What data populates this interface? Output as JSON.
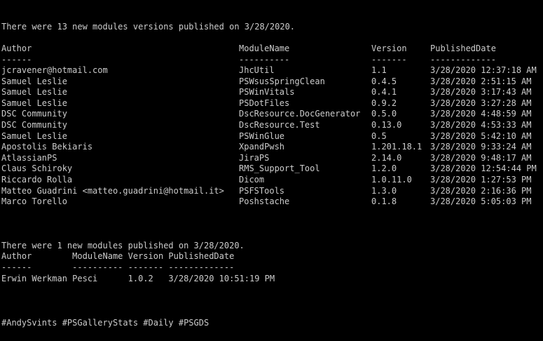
{
  "colors": {
    "background": "#000000",
    "text": "#cccccc"
  },
  "section1": {
    "summary": "There were 13 new modules versions published on 3/28/2020.",
    "headers": [
      "Author",
      "ModuleName",
      "Version",
      "PublishedDate"
    ],
    "separators": [
      "------",
      "----------",
      "-------",
      "-------------"
    ],
    "rows": [
      [
        "jcravener@hotmail.com",
        "JhcUtil",
        "1.1",
        "3/28/2020 12:37:18 AM"
      ],
      [
        "Samuel Leslie",
        "PSWsusSpringClean",
        "0.4.5",
        "3/28/2020 2:51:15 AM"
      ],
      [
        "Samuel Leslie",
        "PSWinVitals",
        "0.4.1",
        "3/28/2020 3:17:43 AM"
      ],
      [
        "Samuel Leslie",
        "PSDotFiles",
        "0.9.2",
        "3/28/2020 3:27:28 AM"
      ],
      [
        "DSC Community",
        "DscResource.DocGenerator",
        "0.5.0",
        "3/28/2020 4:48:59 AM"
      ],
      [
        "DSC Community",
        "DscResource.Test",
        "0.13.0",
        "3/28/2020 4:53:33 AM"
      ],
      [
        "Samuel Leslie",
        "PSWinGlue",
        "0.5",
        "3/28/2020 5:42:10 AM"
      ],
      [
        "Apostolis Bekiaris",
        "XpandPwsh",
        "1.201.18.1",
        "3/28/2020 9:33:24 AM"
      ],
      [
        "AtlassianPS",
        "JiraPS",
        "2.14.0",
        "3/28/2020 9:48:17 AM"
      ],
      [
        "Claus Schiroky",
        "RMS_Support_Tool",
        "1.2.0",
        "3/28/2020 12:54:44 PM"
      ],
      [
        "Riccardo Rolla",
        "Dicom",
        "1.0.11.0",
        "3/28/2020 1:27:53 PM"
      ],
      [
        "Matteo Guadrini <matteo.guadrini@hotmail.it>",
        "PSFSTools",
        "1.3.0",
        "3/28/2020 2:16:36 PM"
      ],
      [
        "Marco Torello",
        "Poshstache",
        "0.1.8",
        "3/28/2020 5:05:03 PM"
      ]
    ]
  },
  "section2": {
    "summary": "There were 1 new modules published on 3/28/2020.",
    "header_line": "Author        ModuleName Version PublishedDate",
    "separator_line": "------        ---------- ------- -------------",
    "rows": [
      "Erwin Werkman Pesci      1.0.2   3/28/2020 10:51:19 PM"
    ]
  },
  "hashtags": "#AndySvints #PSGalleryStats #Daily #PSGDS"
}
